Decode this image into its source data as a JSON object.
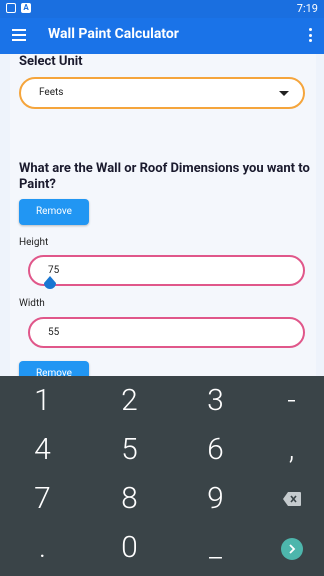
{
  "status": {
    "time": "7:19"
  },
  "appbar": {
    "title": "Wall Paint Calculator"
  },
  "unit": {
    "heading": "Select Unit",
    "selected": "Feets"
  },
  "dimensions": {
    "heading": "What are the Wall or Roof Dimensions you want to Paint?",
    "remove_label": "Remove",
    "height_label": "Height",
    "height_value": "75",
    "width_label": "Width",
    "width_value": "55",
    "remove2_label": "Remove"
  },
  "keyboard": {
    "keys": [
      "1",
      "2",
      "3",
      "-",
      "4",
      "5",
      "6",
      ",",
      "7",
      "8",
      "9",
      ".",
      "0",
      "_"
    ]
  },
  "colors": {
    "app_bar": "#1a73e8",
    "select_border": "#f5a53c",
    "input_border": "#e0578a",
    "button": "#2196f3",
    "keyboard_bg": "#3a4448",
    "go_key": "#4db6ac"
  }
}
